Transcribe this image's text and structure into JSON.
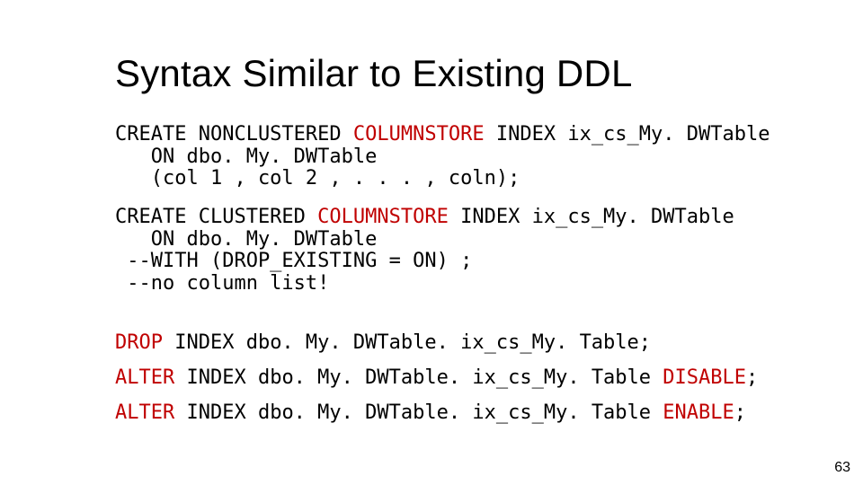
{
  "title": "Syntax Similar to Existing DDL",
  "block1": {
    "l1a": "CREATE NONCLUSTERED ",
    "l1b": "COLUMNSTORE",
    "l1c": " INDEX ix_cs_My. DWTable",
    "l2": "   ON dbo. My. DWTable",
    "l3": "   (col 1 , col 2 , . . . , coln);"
  },
  "block2": {
    "l1a": "CREATE CLUSTERED ",
    "l1b": "COLUMNSTORE",
    "l1c": " INDEX ix_cs_My. DWTable",
    "l2": "   ON dbo. My. DWTable",
    "l3": " --WITH (DROP_EXISTING = ON) ;",
    "l4": " --no column list!"
  },
  "block3": {
    "l1a": "DROP",
    "l1b": " INDEX dbo. My. DWTable. ix_cs_My. Table;"
  },
  "block4": {
    "l1a": "ALTER",
    "l1b": " INDEX dbo. My. DWTable. ix_cs_My. Table ",
    "l1c": "DISABLE",
    "l1d": ";"
  },
  "block5": {
    "l1a": "ALTER",
    "l1b": " INDEX dbo. My. DWTable. ix_cs_My. Table ",
    "l1c": "ENABLE",
    "l1d": ";"
  },
  "page_number": "63"
}
